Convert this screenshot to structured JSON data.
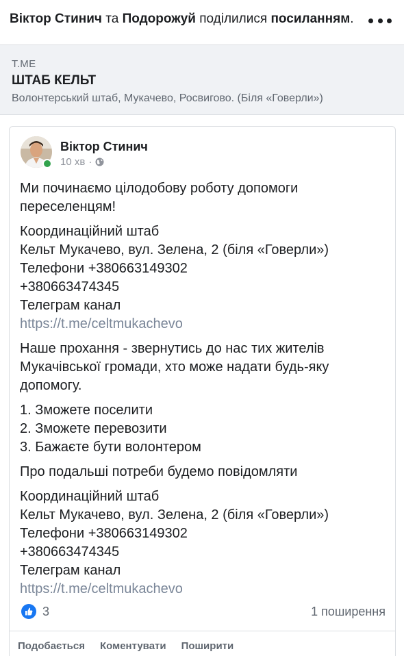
{
  "header": {
    "actor1": "Віктор Стинич",
    "conj": "та",
    "actor2": "Подорожуй",
    "action": "поділилися",
    "object": "посиланням",
    "period": "."
  },
  "link_preview": {
    "domain": "T.ME",
    "title": "ШТАБ КЕЛЬТ",
    "description": "Волонтерський штаб, Мукачево, Росвигово. (Біля «Говерли»)"
  },
  "post": {
    "author": "Віктор Стинич",
    "time": "10 хв",
    "separator": "·",
    "body": {
      "p1": [
        "Ми починаємо цілодобову роботу допомоги",
        "переселенцям!"
      ],
      "p2": [
        "Координаційний штаб",
        "Кельт Мукачево, вул. Зелена, 2 (біля «Говерли»)",
        "Телефони +380663149302",
        "+380663474345",
        "Телеграм канал"
      ],
      "p2_link": "https://t.me/celtmukachevo",
      "p3": [
        "Наше прохання - звернутись до нас тих жителів",
        "Мукачівської громади, хто може надати будь-яку",
        "допомогу."
      ],
      "p4": [
        "1. Зможете поселити",
        "2. Зможете перевозити",
        "3. Бажаєте бути волонтером"
      ],
      "p5": [
        "Про подальші потреби будемо повідомляти"
      ],
      "p6": [
        "Координаційний штаб",
        "Кельт Мукачево, вул. Зелена, 2 (біля «Говерли»)",
        "Телефони +380663149302",
        "+380663474345",
        "Телеграм канал"
      ],
      "p6_link": "https://t.me/celtmukachevo"
    },
    "likes": "3",
    "shares": "1 поширення",
    "actions": {
      "like": "Подобається",
      "comment": "Коментувати",
      "share": "Поширити"
    }
  },
  "colors": {
    "like_blue": "#1877f2",
    "online_green": "#31a24c",
    "link_gray": "#7a8698"
  }
}
